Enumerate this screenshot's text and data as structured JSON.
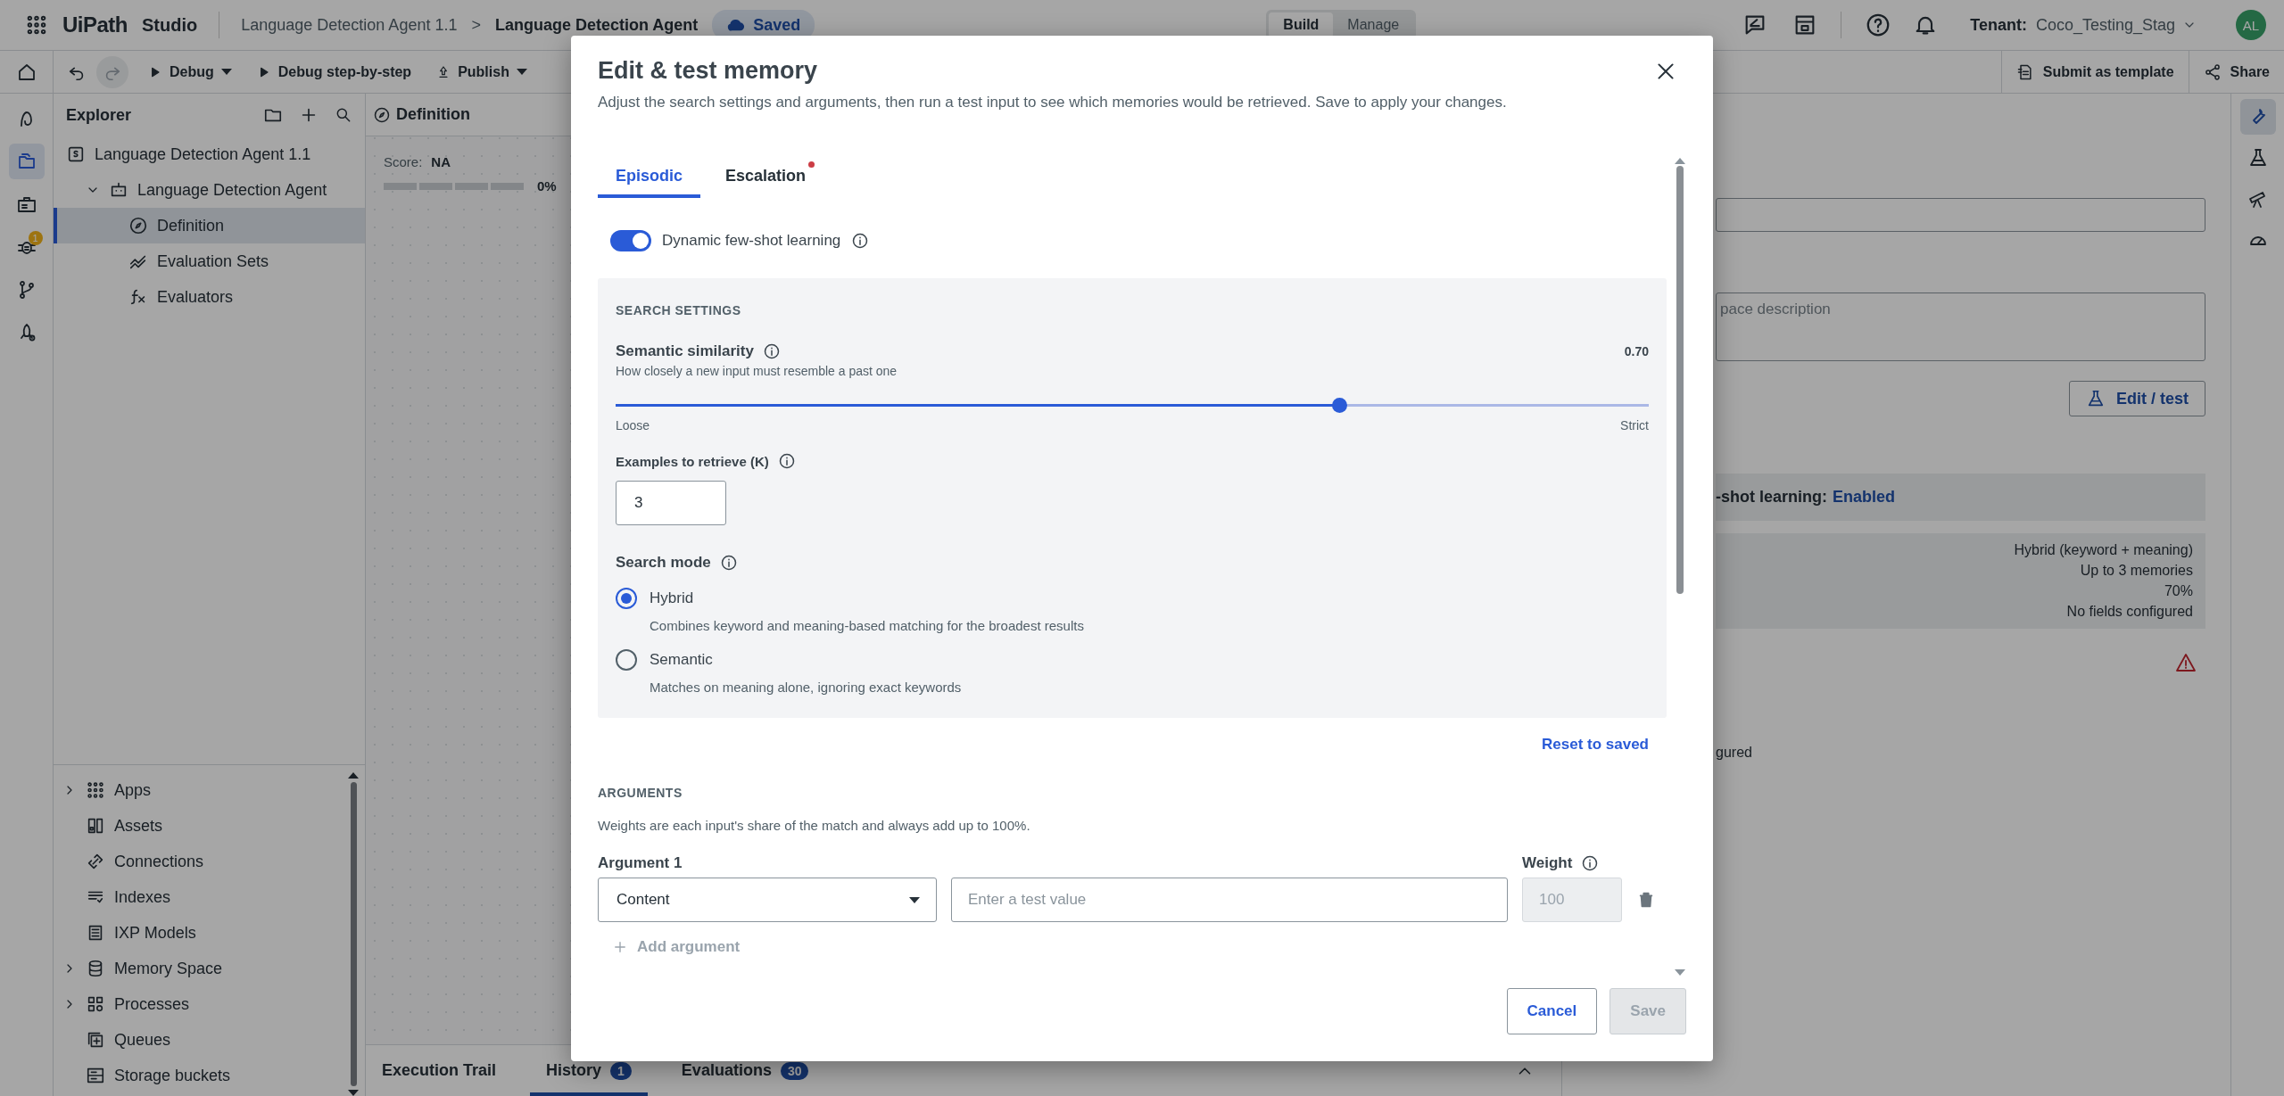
{
  "top_bar": {
    "logo": "UiPath",
    "product": "Studio",
    "breadcrumb": [
      "Language Detection Agent 1.1",
      "Language Detection Agent"
    ],
    "breadcrumb_separator": ">",
    "save_status": "Saved",
    "mode_tabs": [
      {
        "label": "Build",
        "selected": true
      },
      {
        "label": "Manage",
        "selected": false
      }
    ],
    "tenant_label": "Tenant:",
    "tenant": "Coco_Testing_Stag",
    "avatar": "AL"
  },
  "toolbar": {
    "history_buttons": [
      {
        "kind": "undo",
        "disabled": false
      },
      {
        "kind": "redo",
        "disabled": true
      }
    ],
    "buttons": [
      {
        "label": "Debug",
        "kind": "run",
        "dropdown": true
      },
      {
        "label": "Debug step-by-step",
        "kind": "run",
        "dropdown": false
      },
      {
        "label": "Publish",
        "kind": "publish",
        "dropdown": true
      }
    ],
    "right_buttons": [
      {
        "label": "Submit as template",
        "kind": "template"
      },
      {
        "label": "Share",
        "kind": "share"
      }
    ]
  },
  "activity_bar": {
    "items": [
      {
        "kind": "agent",
        "selected": false
      },
      {
        "kind": "files",
        "selected": true
      },
      {
        "kind": "briefcase",
        "selected": false
      },
      {
        "kind": "bug",
        "selected": false,
        "badge": "1"
      },
      {
        "kind": "branch",
        "selected": false
      },
      {
        "kind": "rocket",
        "selected": false
      }
    ]
  },
  "explorer": {
    "title": "Explorer",
    "tree": [
      {
        "label": "Language Detection Agent 1.1",
        "kind": "solution",
        "selected": false,
        "children": [
          {
            "label": "Language Detection Agent",
            "kind": "agent",
            "selected": false,
            "expanded": true,
            "children": [
              {
                "label": "Definition",
                "kind": "compass",
                "selected": true
              },
              {
                "label": "Evaluation Sets",
                "kind": "chart",
                "selected": false
              },
              {
                "label": "Evaluators",
                "kind": "fx",
                "selected": false
              }
            ]
          }
        ]
      }
    ],
    "resources": [
      {
        "label": "Apps",
        "kind": "apps",
        "expanded": false
      },
      {
        "label": "Assets",
        "kind": "assets"
      },
      {
        "label": "Connections",
        "kind": "link"
      },
      {
        "label": "Indexes",
        "kind": "index"
      },
      {
        "label": "IXP Models",
        "kind": "doc"
      },
      {
        "label": "Memory Space",
        "kind": "db",
        "expanded": false
      },
      {
        "label": "Processes",
        "kind": "process",
        "expanded": false
      },
      {
        "label": "Queues",
        "kind": "queue"
      },
      {
        "label": "Storage buckets",
        "kind": "bucket"
      }
    ]
  },
  "canvas": {
    "title": "Definition",
    "score_label": "Score:",
    "score": "NA",
    "score_bar": {
      "level": 0,
      "reading": "0%"
    },
    "bottom_tabs": [
      {
        "label": "Execution Trail",
        "selected": false
      },
      {
        "label": "History",
        "badge": "1",
        "selected": true
      },
      {
        "label": "Evaluations",
        "badge": "30",
        "selected": false
      }
    ]
  },
  "right_panel": {
    "description_placeholder": "pace description",
    "edit_button": "Edit / test",
    "memory_status_label": "-shot learning:",
    "memory_status": "Enabled",
    "summary_values": [
      "Hybrid (keyword + meaning)",
      "Up to 3 memories",
      "70%",
      "No fields configured"
    ],
    "trailing_text": "gured"
  },
  "right_rail": {
    "items": [
      {
        "kind": "wrench",
        "selected": true
      },
      {
        "kind": "flask",
        "selected": false
      },
      {
        "kind": "telescope",
        "selected": false
      },
      {
        "kind": "gauge",
        "selected": false
      }
    ]
  },
  "dialog": {
    "title": "Edit & test memory",
    "description": "Adjust the search settings and arguments, then run a test input to see which memories would be retrieved. Save to apply your changes.",
    "tabs": [
      {
        "label": "Episodic",
        "selected": true,
        "dot": false
      },
      {
        "label": "Escalation",
        "selected": false,
        "dot": true
      }
    ],
    "toggle": {
      "label": "Dynamic few-shot learning",
      "on": true
    },
    "search_settings": {
      "heading": "SEARCH SETTINGS",
      "similarity": {
        "label": "Semantic similarity",
        "value": "0.70",
        "help": "How closely a new input must resemble a past one",
        "level": 0.7,
        "min_label": "Loose",
        "max_label": "Strict"
      },
      "examples": {
        "label": "Examples to retrieve (K)",
        "value": "3"
      },
      "search_mode": {
        "label": "Search mode",
        "options": [
          {
            "label": "Hybrid",
            "description": "Combines keyword and meaning-based matching for the broadest results",
            "selected": true
          },
          {
            "label": "Semantic",
            "description": "Matches on meaning alone, ignoring exact keywords",
            "selected": false
          }
        ]
      }
    },
    "reset_link": "Reset to saved",
    "arguments": {
      "heading": "ARGUMENTS",
      "note": "Weights are each input's share of the match and always add up to 100%.",
      "items": [
        {
          "label": "Argument 1",
          "weight_label": "Weight",
          "field": "Content",
          "placeholder": "Enter a test value",
          "weight": "100",
          "weight_disabled": true
        }
      ],
      "add_button": "Add argument"
    },
    "buttons": [
      {
        "label": "Cancel",
        "kind": "secondary",
        "disabled": false
      },
      {
        "label": "Save",
        "kind": "primary",
        "disabled": true
      }
    ]
  }
}
